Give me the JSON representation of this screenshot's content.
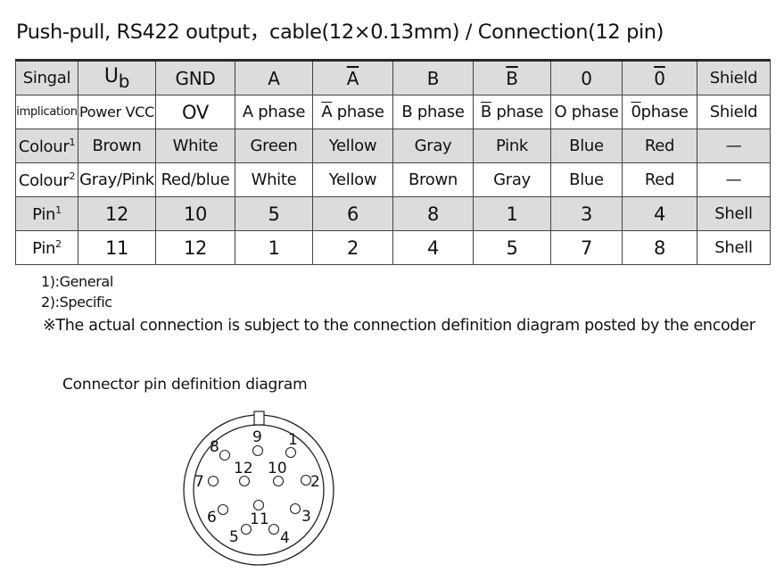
{
  "title": "Push-pull, RS422 output，cable(12×0.13mm) / Connection(12 pin)",
  "table": {
    "rows": [
      {
        "label": "Singal",
        "cells": [
          "U",
          "GND",
          "A",
          "A",
          "B",
          "B",
          "0",
          "0",
          "Shield"
        ],
        "ub_subscript": "b",
        "overlined_columns": [
          3,
          5,
          7
        ]
      },
      {
        "label": "implication",
        "cells": [
          "Power VCC",
          "OV",
          "A phase",
          "A",
          "B phase",
          "B",
          "O phase",
          "0",
          "Shield"
        ],
        "phase_suffix": "phase",
        "overlined_columns": [
          3,
          5,
          7
        ]
      },
      {
        "label": "Colour",
        "label_sup": "1",
        "cells": [
          "Brown",
          "White",
          "Green",
          "Yellow",
          "Gray",
          "Pink",
          "Blue",
          "Red",
          "—"
        ]
      },
      {
        "label": "Colour",
        "label_sup": "2",
        "cells": [
          "Gray/Pink",
          "Red/blue",
          "White",
          "Yellow",
          "Brown",
          "Gray",
          "Blue",
          "Red",
          "—"
        ]
      },
      {
        "label": "Pin",
        "label_sup": "1",
        "cells": [
          "12",
          "10",
          "5",
          "6",
          "8",
          "1",
          "3",
          "4",
          "Shell"
        ]
      },
      {
        "label": "Pin",
        "label_sup": "2",
        "cells": [
          "11",
          "12",
          "1",
          "2",
          "4",
          "5",
          "7",
          "8",
          "Shell"
        ]
      }
    ]
  },
  "notes": {
    "n1": "1):General",
    "n2": "2):Specific",
    "n3": "※The actual connection is subject to the connection definition diagram posted by the encoder"
  },
  "diagram": {
    "title": "Connector pin definition diagram",
    "pins": [
      "1",
      "2",
      "3",
      "4",
      "5",
      "6",
      "7",
      "8",
      "9",
      "10",
      "11",
      "12"
    ]
  }
}
